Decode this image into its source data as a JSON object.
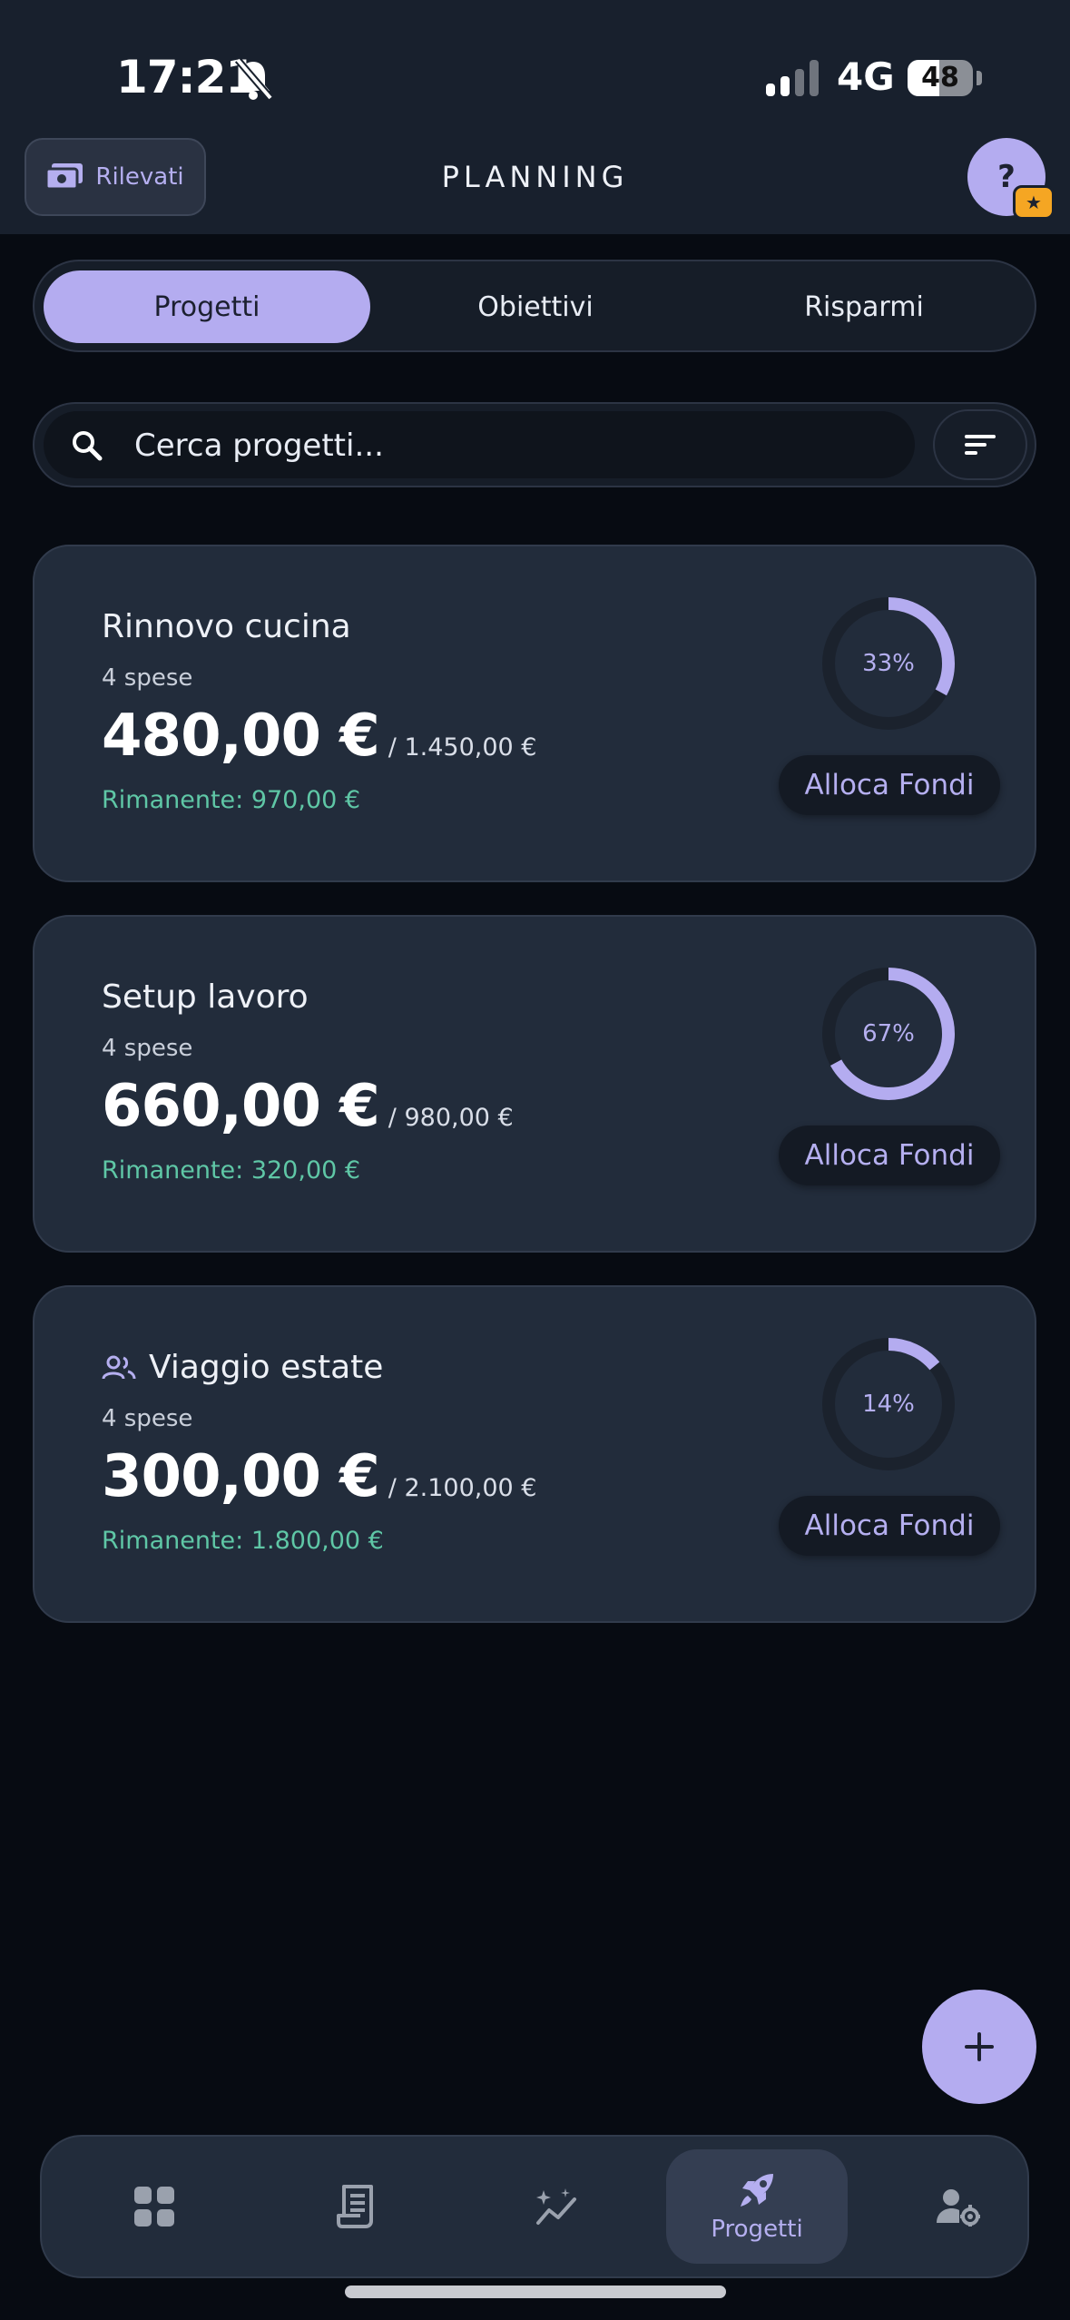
{
  "status_bar": {
    "time": "17:21",
    "network": "4G",
    "battery": "48",
    "battery_level": 0.48
  },
  "header": {
    "rilevati_label": "Rilevati",
    "title": "PLANNING",
    "help_label": "?",
    "help_badge": "★"
  },
  "tabs": [
    {
      "label": "Progetti",
      "active": true
    },
    {
      "label": "Obiettivi",
      "active": false
    },
    {
      "label": "Risparmi",
      "active": false
    }
  ],
  "search": {
    "placeholder": "Cerca progetti..."
  },
  "projects": [
    {
      "title": "Rinnovo cucina",
      "expenses": "4 spese",
      "amount": "480,00 €",
      "total": "/ 1.450,00 €",
      "remaining": "Rimanente: 970,00 €",
      "percent_label": "33%",
      "percent": 33,
      "shared": false,
      "action_label": "Alloca Fondi"
    },
    {
      "title": "Setup lavoro",
      "expenses": "4 spese",
      "amount": "660,00 €",
      "total": "/ 980,00 €",
      "remaining": "Rimanente: 320,00 €",
      "percent_label": "67%",
      "percent": 67,
      "shared": false,
      "action_label": "Alloca Fondi"
    },
    {
      "title": "Viaggio estate",
      "expenses": "4 spese",
      "amount": "300,00 €",
      "total": "/ 2.100,00 €",
      "remaining": "Rimanente: 1.800,00 €",
      "percent_label": "14%",
      "percent": 14,
      "shared": true,
      "action_label": "Alloca Fondi"
    }
  ],
  "bottom_nav": {
    "items": [
      {
        "icon": "dashboard-icon"
      },
      {
        "icon": "receipt-icon"
      },
      {
        "icon": "insights-icon"
      },
      {
        "icon": "rocket-icon",
        "label": "Progetti",
        "active": true
      },
      {
        "icon": "user-settings-icon"
      }
    ]
  },
  "colors": {
    "accent": "#b4acf0",
    "remaining": "#5fc7a6",
    "card_bg": "#222c3b",
    "badge": "#f5a623"
  }
}
